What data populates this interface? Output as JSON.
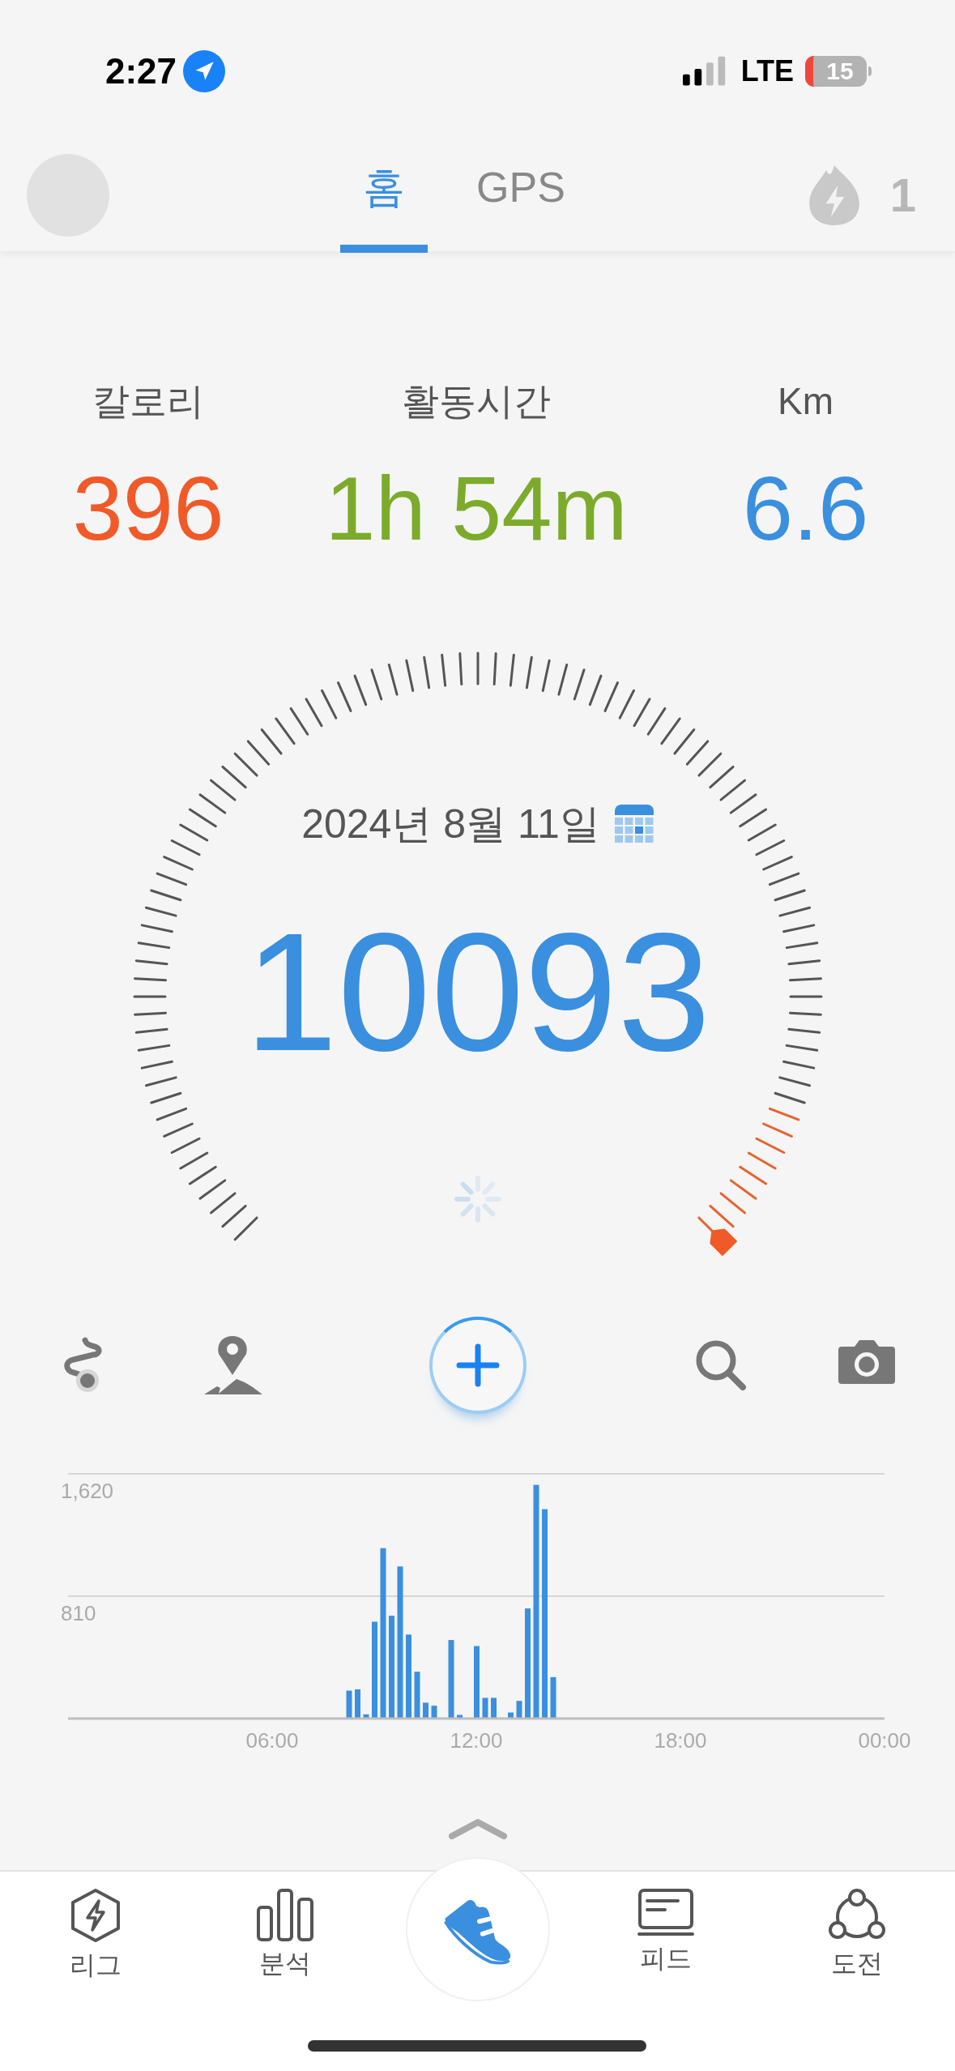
{
  "status_bar": {
    "time": "2:27",
    "network": "LTE",
    "battery": "15"
  },
  "header": {
    "tabs": [
      {
        "label": "홈",
        "selected": true
      },
      {
        "label": "GPS",
        "selected": false
      }
    ],
    "streak": "1"
  },
  "stats": [
    {
      "label": "칼로리",
      "value": "396",
      "color": "#f05a28"
    },
    {
      "label": "활동시간",
      "value": "1h 54m",
      "color": "#7cab2c"
    },
    {
      "label": "Km",
      "value": "6.6",
      "color": "#3a8fdf"
    }
  ],
  "gauge": {
    "date": "2024년 8월 11일",
    "steps": "10093"
  },
  "chart": {
    "chart_data": {
      "type": "bar",
      "x": [
        8.25,
        8.5,
        8.75,
        9,
        9.25,
        9.5,
        9.75,
        10,
        10.25,
        10.5,
        10.75,
        11,
        11.25,
        11.5,
        11.75,
        12,
        12.25,
        12.5,
        12.75,
        13,
        13.25,
        13.5,
        13.75,
        14,
        14.25
      ],
      "values": [
        185,
        193,
        28,
        641,
        1128,
        681,
        1007,
        556,
        310,
        105,
        85,
        0,
        520,
        24,
        0,
        480,
        137,
        137,
        0,
        40,
        117,
        729,
        1547,
        1386,
        274
      ],
      "xlim": [
        0,
        24
      ],
      "ylim": [
        0,
        1620
      ],
      "xticks": [
        {
          "value": 6,
          "label": "06:00"
        },
        {
          "value": 12,
          "label": "12:00"
        },
        {
          "value": 18,
          "label": "18:00"
        },
        {
          "value": 24,
          "label": "00:00"
        }
      ],
      "yticks": [
        {
          "value": 810,
          "label": "810"
        },
        {
          "value": 1620,
          "label": "1,620"
        }
      ]
    }
  },
  "nav": [
    {
      "kind": "league",
      "label": "리그",
      "selected": false
    },
    {
      "kind": "analysis",
      "label": "분석",
      "selected": false
    },
    {
      "kind": "walk",
      "selected": true
    },
    {
      "kind": "feed",
      "label": "피드",
      "selected": false
    },
    {
      "kind": "challenge",
      "label": "도전",
      "selected": false
    }
  ]
}
